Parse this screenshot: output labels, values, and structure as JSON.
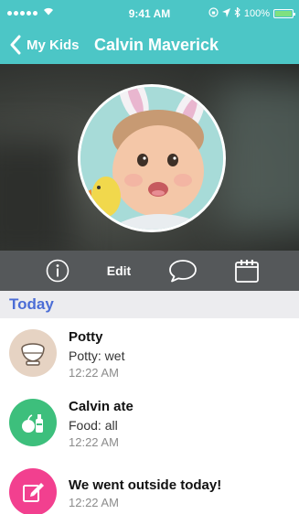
{
  "status_bar": {
    "time": "9:41 AM",
    "battery": "100%",
    "icons": [
      "signal-dots-icon",
      "wifi-icon",
      "rotation-lock-icon",
      "location-icon",
      "bluetooth-icon",
      "battery-icon"
    ]
  },
  "nav": {
    "back_label": "My Kids",
    "title": "Calvin Maverick"
  },
  "toolbar": {
    "info_icon": "info-icon",
    "edit_label": "Edit",
    "message_icon": "chat-bubble-icon",
    "calendar_icon": "calendar-icon"
  },
  "feed": {
    "section_title": "Today",
    "items": [
      {
        "title": "Potty",
        "detail": "Potty: wet",
        "time": "12:22 AM",
        "icon": "potty-icon",
        "color": "#e6d3c3"
      },
      {
        "title": "Calvin ate",
        "detail": "Food: all",
        "time": "12:22 AM",
        "icon": "food-icon",
        "color": "#3dbf7c"
      },
      {
        "title": "We went outside today!",
        "detail": "",
        "time": "12:22 AM",
        "icon": "note-pencil-icon",
        "color": "#f2408f"
      }
    ]
  },
  "colors": {
    "header": "#4cc6c6",
    "toolbar": "#55585a",
    "section_title": "#4b6dd6"
  }
}
